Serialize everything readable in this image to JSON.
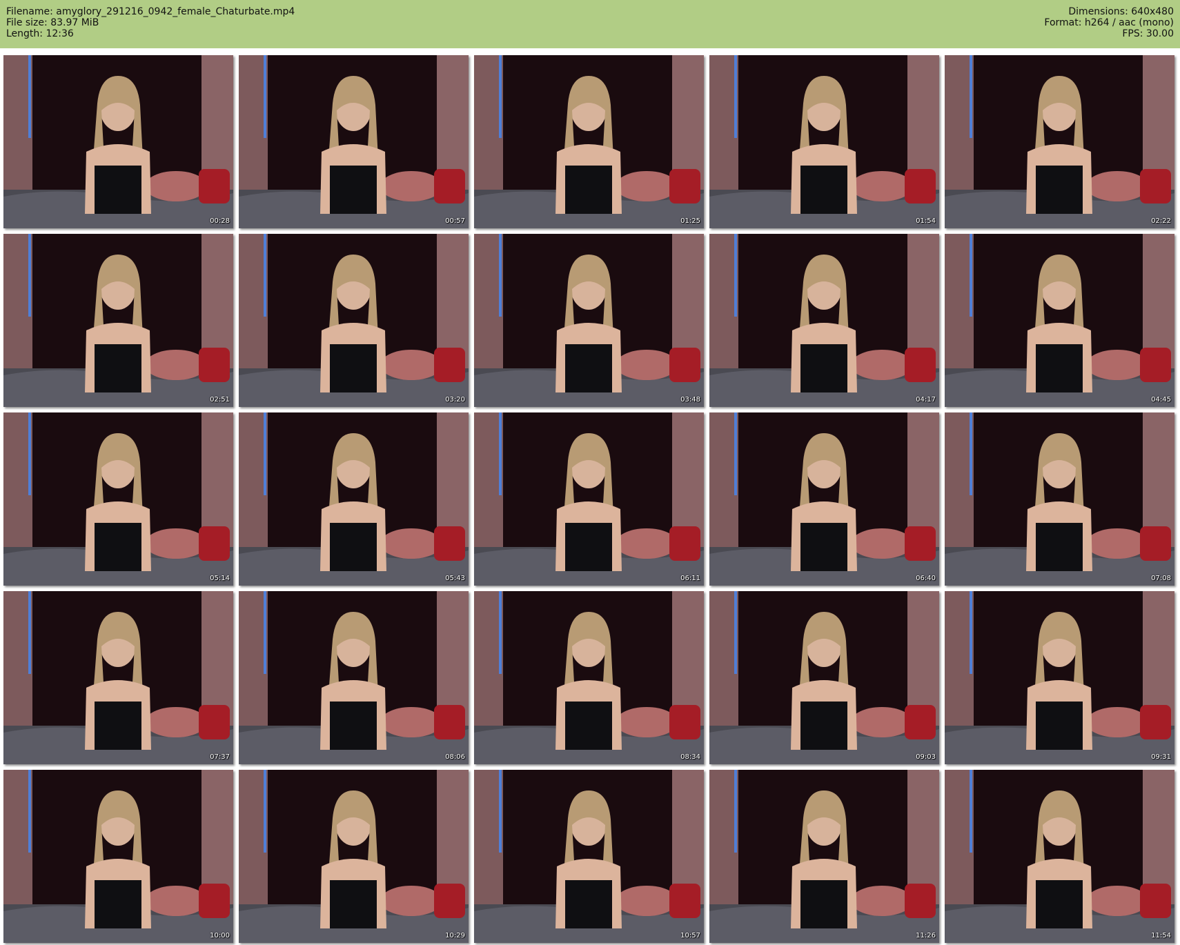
{
  "header": {
    "filename_line": "Filename: amyglory_291216_0942_female_Chaturbate.mp4",
    "filesize_line": "File size: 83.97 MiB",
    "length_line": "Length: 12:36",
    "dimensions_line": "Dimensions: 640x480",
    "format_line": "Format: h264 / aac (mono)",
    "fps_line": "FPS: 30.00"
  },
  "colors": {
    "header_bg": "#b1cd85",
    "page_bg": "#ffffff",
    "timestamp_text": "#ffffff"
  },
  "thumbnails": [
    {
      "timestamp": "00:28"
    },
    {
      "timestamp": "00:57"
    },
    {
      "timestamp": "01:25"
    },
    {
      "timestamp": "01:54"
    },
    {
      "timestamp": "02:22"
    },
    {
      "timestamp": "02:51"
    },
    {
      "timestamp": "03:20"
    },
    {
      "timestamp": "03:48"
    },
    {
      "timestamp": "04:17"
    },
    {
      "timestamp": "04:45"
    },
    {
      "timestamp": "05:14"
    },
    {
      "timestamp": "05:43"
    },
    {
      "timestamp": "06:11"
    },
    {
      "timestamp": "06:40"
    },
    {
      "timestamp": "07:08"
    },
    {
      "timestamp": "07:37"
    },
    {
      "timestamp": "08:06"
    },
    {
      "timestamp": "08:34"
    },
    {
      "timestamp": "09:03"
    },
    {
      "timestamp": "09:31"
    },
    {
      "timestamp": "10:00"
    },
    {
      "timestamp": "10:29"
    },
    {
      "timestamp": "10:57"
    },
    {
      "timestamp": "11:26"
    },
    {
      "timestamp": "11:54"
    }
  ]
}
